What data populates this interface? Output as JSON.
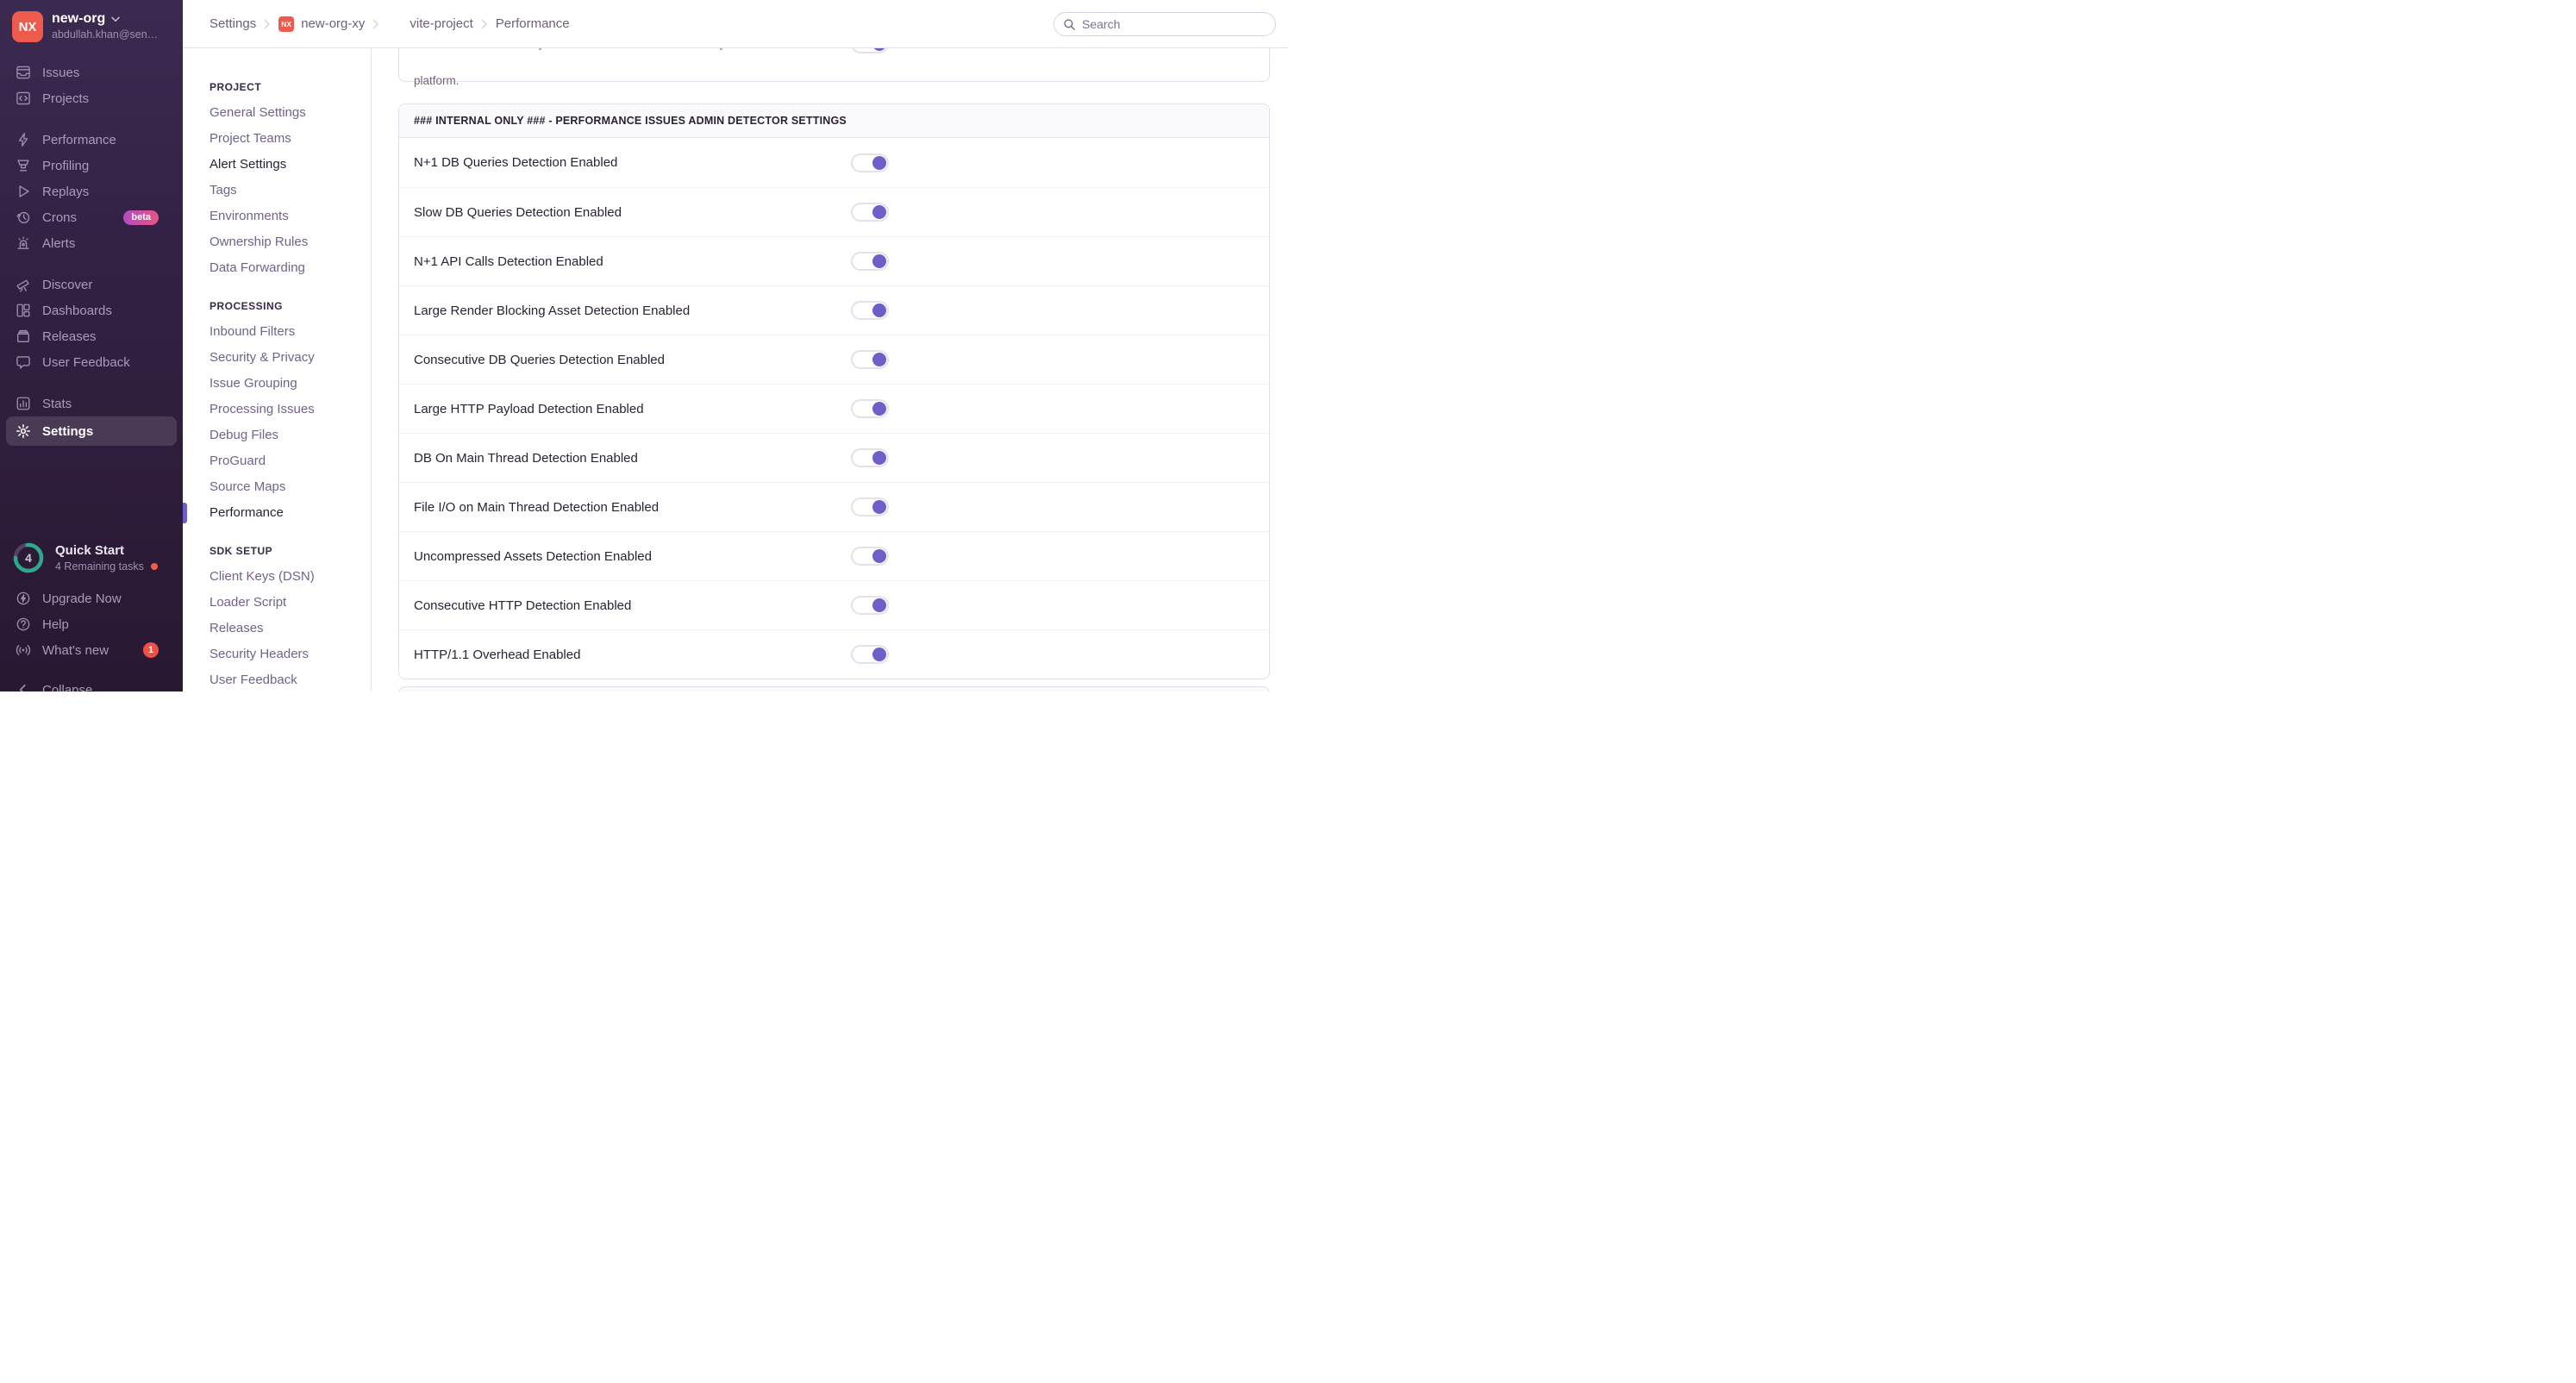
{
  "colors": {
    "accent_purple": "#6C5FC7",
    "sidebar_top": "#3b2a50",
    "sidebar_bottom": "#281831",
    "org_avatar_red": "#ee5a4c",
    "react_icon_bg": "#59cdf5",
    "beta_badge_gradient_start": "#b14bc4",
    "beta_badge_gradient_end": "#e85580",
    "notification_red": "#ef5045",
    "quickstart_ring_teal": "#2fa98e",
    "quickstart_dot_orange": "#f05c45"
  },
  "sidebar": {
    "org": {
      "initials": "NX",
      "name": "new-org",
      "email": "abdullah.khan@sen…"
    },
    "groups": [
      {
        "items": [
          {
            "icon": "issues",
            "label": "Issues"
          },
          {
            "icon": "projects",
            "label": "Projects"
          }
        ]
      },
      {
        "items": [
          {
            "icon": "performance",
            "label": "Performance"
          },
          {
            "icon": "profiling",
            "label": "Profiling"
          },
          {
            "icon": "replays",
            "label": "Replays"
          },
          {
            "icon": "crons",
            "label": "Crons",
            "badge": "beta",
            "badge_style": "gradient-pill"
          },
          {
            "icon": "alerts",
            "label": "Alerts"
          }
        ]
      },
      {
        "items": [
          {
            "icon": "discover",
            "label": "Discover"
          },
          {
            "icon": "dashboards",
            "label": "Dashboards"
          },
          {
            "icon": "releases",
            "label": "Releases"
          },
          {
            "icon": "user-feedback",
            "label": "User Feedback"
          }
        ]
      },
      {
        "items": [
          {
            "icon": "stats",
            "label": "Stats"
          },
          {
            "icon": "settings",
            "label": "Settings",
            "active": true
          }
        ]
      }
    ],
    "quick_start": {
      "label": "Quick Start",
      "subtitle": "4 Remaining tasks",
      "count": "4"
    },
    "footer": [
      {
        "icon": "upgrade",
        "label": "Upgrade Now"
      },
      {
        "icon": "help",
        "label": "Help"
      },
      {
        "icon": "whats-new",
        "label": "What's new",
        "badge": "1",
        "badge_style": "red-circle"
      },
      {
        "icon": "collapse",
        "label": "Collapse",
        "collapse": true
      }
    ]
  },
  "topbar": {
    "breadcrumbs": [
      {
        "label": "Settings"
      },
      {
        "label": "new-org-xy",
        "avatar_text": "NX"
      },
      {
        "label": "vite-project",
        "avatar_icon": "react"
      },
      {
        "label": "Performance"
      }
    ],
    "search_placeholder": "Search"
  },
  "subnav": {
    "active_item": "Performance",
    "emphasis_item": "Alert Settings",
    "sections": [
      {
        "title": "PROJECT",
        "items": [
          "General Settings",
          "Project Teams",
          "Alert Settings",
          "Tags",
          "Environments",
          "Ownership Rules",
          "Data Forwarding"
        ]
      },
      {
        "title": "PROCESSING",
        "items": [
          "Inbound Filters",
          "Security & Privacy",
          "Issue Grouping",
          "Processing Issues",
          "Debug Files",
          "ProGuard",
          "Source Maps",
          "Performance"
        ]
      },
      {
        "title": "SDK SETUP",
        "items": [
          "Client Keys (DSN)",
          "Loader Script",
          "Releases",
          "Security Headers",
          "User Feedback"
        ]
      }
    ]
  },
  "content": {
    "partial_card_text": "platform.",
    "panel_title": "### INTERNAL ONLY ### - PERFORMANCE ISSUES ADMIN DETECTOR SETTINGS",
    "toggles": [
      {
        "label": "N+1 DB Queries Detection Enabled",
        "enabled": true
      },
      {
        "label": "Slow DB Queries Detection Enabled",
        "enabled": true
      },
      {
        "label": "N+1 API Calls Detection Enabled",
        "enabled": true
      },
      {
        "label": "Large Render Blocking Asset Detection Enabled",
        "enabled": true
      },
      {
        "label": "Consecutive DB Queries Detection Enabled",
        "enabled": true
      },
      {
        "label": "Large HTTP Payload Detection Enabled",
        "enabled": true
      },
      {
        "label": "DB On Main Thread Detection Enabled",
        "enabled": true
      },
      {
        "label": "File I/O on Main Thread Detection Enabled",
        "enabled": true
      },
      {
        "label": "Uncompressed Assets Detection Enabled",
        "enabled": true
      },
      {
        "label": "Consecutive HTTP Detection Enabled",
        "enabled": true
      },
      {
        "label": "HTTP/1.1 Overhead Enabled",
        "enabled": true
      }
    ]
  }
}
